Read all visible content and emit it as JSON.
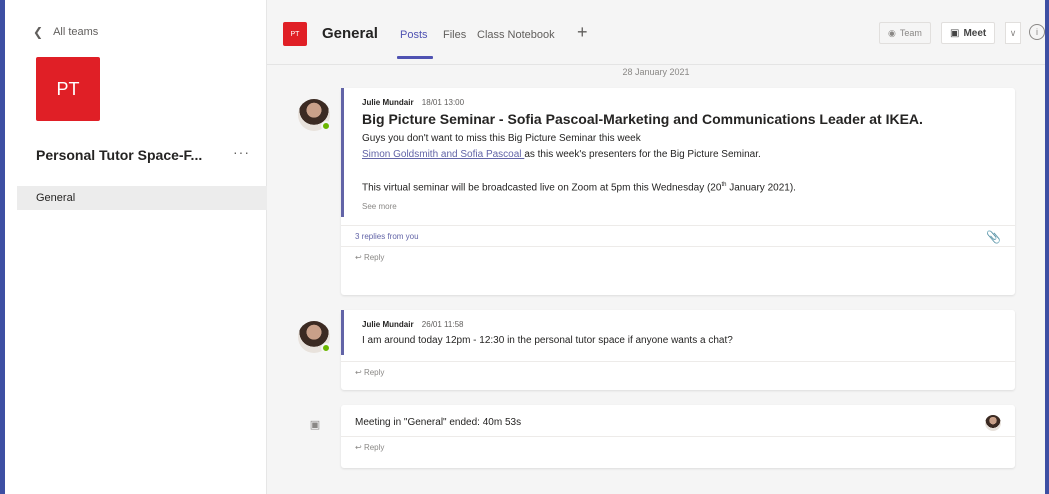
{
  "sidebar": {
    "back_label": "All teams",
    "team_initials": "PT",
    "team_name": "Personal Tutor Space-F...",
    "more": "···",
    "channels": [
      {
        "label": "General"
      }
    ]
  },
  "header": {
    "channel_initials": "PT",
    "channel_title": "General",
    "tabs": [
      {
        "label": "Posts"
      },
      {
        "label": "Files"
      },
      {
        "label": "Class Notebook"
      }
    ],
    "add_tab": "+",
    "team_button": "Team",
    "meet_button": "Meet",
    "meet_drop": "∨",
    "info": "i"
  },
  "date_separator": "28 January 2021",
  "posts": [
    {
      "author": "Julie Mundair",
      "time": "18/01 13:00",
      "subject": "Big Picture Seminar - Sofia Pascoal-Marketing and Communications Leader at IKEA.",
      "line1": "Guys you don't want to miss this Big Picture Seminar this week",
      "link_text": "Simon Goldsmith and Sofia Pascoal ",
      "line2_rest": "as this week's presenters for the Big Picture Seminar.",
      "line3_pre": "This virtual seminar will be broadcasted live on Zoom at 5pm this Wednesday (20",
      "line3_sup": "th",
      "line3_post": " January 2021).",
      "see_more": "See more",
      "replies": "3 replies from you",
      "reply": "Reply"
    },
    {
      "author": "Julie Mundair",
      "time": "26/01 11:58",
      "text": "I am around today 12pm - 12:30 in the personal tutor space if anyone wants a chat?",
      "reply": "Reply"
    },
    {
      "text": "Meeting in \"General\" ended: 40m 53s",
      "reply": "Reply"
    }
  ],
  "colors": {
    "brand": "#e01f26",
    "accent": "#6264a7",
    "presence": "#6bb700"
  }
}
